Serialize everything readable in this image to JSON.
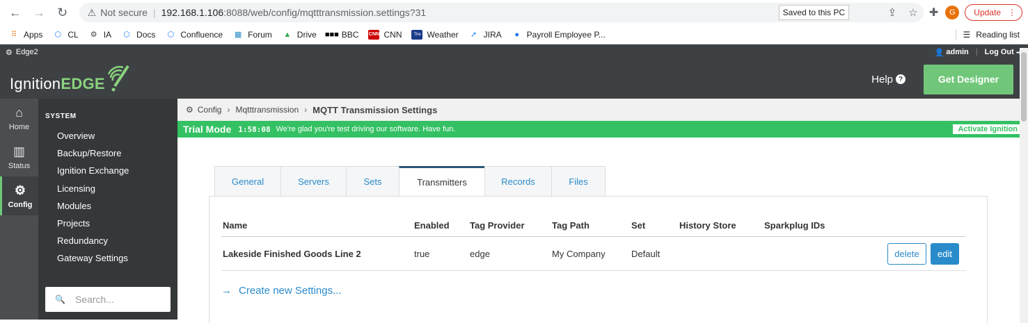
{
  "browser": {
    "security_label": "Not secure",
    "url_host": "192.168.1.106",
    "url_path": ":8088/web/config/mqtttransmission.settings?31",
    "saved_chip": "Saved to this PC",
    "avatar_letter": "G",
    "update_label": "Update"
  },
  "bookmarks": {
    "items": [
      {
        "label": "Apps",
        "icon": "apps-grid-icon",
        "color": "#e8710a"
      },
      {
        "label": "CL",
        "icon": "confluence-icon",
        "color": "#2684ff"
      },
      {
        "label": "IA",
        "icon": "gear-icon",
        "color": "#444444"
      },
      {
        "label": "Docs",
        "icon": "confluence-icon",
        "color": "#2684ff"
      },
      {
        "label": "Confluence",
        "icon": "confluence-icon",
        "color": "#2684ff"
      },
      {
        "label": "Forum",
        "icon": "forum-icon",
        "color": "#2a8bca"
      },
      {
        "label": "Drive",
        "icon": "drive-icon",
        "color": "#34a853"
      },
      {
        "label": "BBC",
        "icon": "bbc-icon",
        "color": "#000000"
      },
      {
        "label": "CNN",
        "icon": "cnn-icon",
        "color": "#cc0000"
      },
      {
        "label": "Weather",
        "icon": "weather-icon",
        "color": "#1a3a8a"
      },
      {
        "label": "JIRA",
        "icon": "jira-icon",
        "color": "#2684ff"
      },
      {
        "label": "Payroll Employee P...",
        "icon": "payroll-icon",
        "color": "#1a73e8"
      }
    ],
    "reading_list": "Reading list"
  },
  "gateway": {
    "name": "Edge2",
    "user": "admin",
    "logout": "Log Out"
  },
  "header": {
    "logo_main": "Ignition",
    "logo_edge": "EDGE",
    "help": "Help",
    "get_designer": "Get Designer"
  },
  "rail": [
    {
      "label": "Home",
      "icon": "home-icon"
    },
    {
      "label": "Status",
      "icon": "bar-chart-icon"
    },
    {
      "label": "Config",
      "icon": "gear-icon",
      "active": true
    }
  ],
  "sidebar": {
    "section": "SYSTEM",
    "items": [
      "Overview",
      "Backup/Restore",
      "Ignition Exchange",
      "Licensing",
      "Modules",
      "Projects",
      "Redundancy",
      "Gateway Settings"
    ],
    "search_placeholder": "Search..."
  },
  "breadcrumb": {
    "items": [
      "Config",
      "Mqtttransmission"
    ],
    "current": "MQTT Transmission Settings"
  },
  "trial": {
    "label": "Trial Mode",
    "clock": "1:58:08",
    "message": "We're glad you're test driving our software. Have fun.",
    "activate": "Activate Ignition"
  },
  "tabs": [
    "General",
    "Servers",
    "Sets",
    "Transmitters",
    "Records",
    "Files"
  ],
  "active_tab": "Transmitters",
  "table": {
    "headers": [
      "Name",
      "Enabled",
      "Tag Provider",
      "Tag Path",
      "Set",
      "History Store",
      "Sparkplug IDs"
    ],
    "rows": [
      {
        "name": "Lakeside Finished Goods Line 2",
        "enabled": "true",
        "tag_provider": "edge",
        "tag_path": "My Company",
        "set": "Default",
        "history_store": "",
        "sparkplug_ids": "",
        "delete": "delete",
        "edit": "edit"
      }
    ]
  },
  "create_new": "Create new Settings..."
}
